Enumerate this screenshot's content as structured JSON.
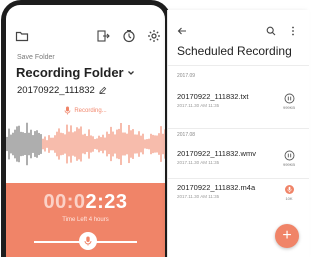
{
  "recorder": {
    "save_label": "Save Folder",
    "folder_title": "Recording Folder",
    "file_name": "20170922_111832",
    "status": "Recording...",
    "timer_dim": "00:0",
    "timer_bright": "2:23",
    "time_left": "Time Left 4 hours"
  },
  "schedule": {
    "title": "Scheduled Recording",
    "groups": [
      {
        "date": "2017.09",
        "items": [
          {
            "name": "20170922_111832.txt",
            "meta": "2017.11.30 AM 11:35",
            "size": "999KB",
            "icon": "pause-icon"
          }
        ]
      },
      {
        "date": "2017.08",
        "items": [
          {
            "name": "20170922_111832.wmv",
            "meta": "2017.11.30 AM 11:35",
            "size": "999KB",
            "icon": "pause-icon"
          },
          {
            "name": "20170922_111832.m4a",
            "meta": "2017.11.30 AM 11:35",
            "size": "10K",
            "icon": "record-icon"
          }
        ]
      }
    ],
    "fab_label": "+"
  },
  "colors": {
    "accent": "#f08468",
    "phone_frame": "#1d1d1d"
  }
}
